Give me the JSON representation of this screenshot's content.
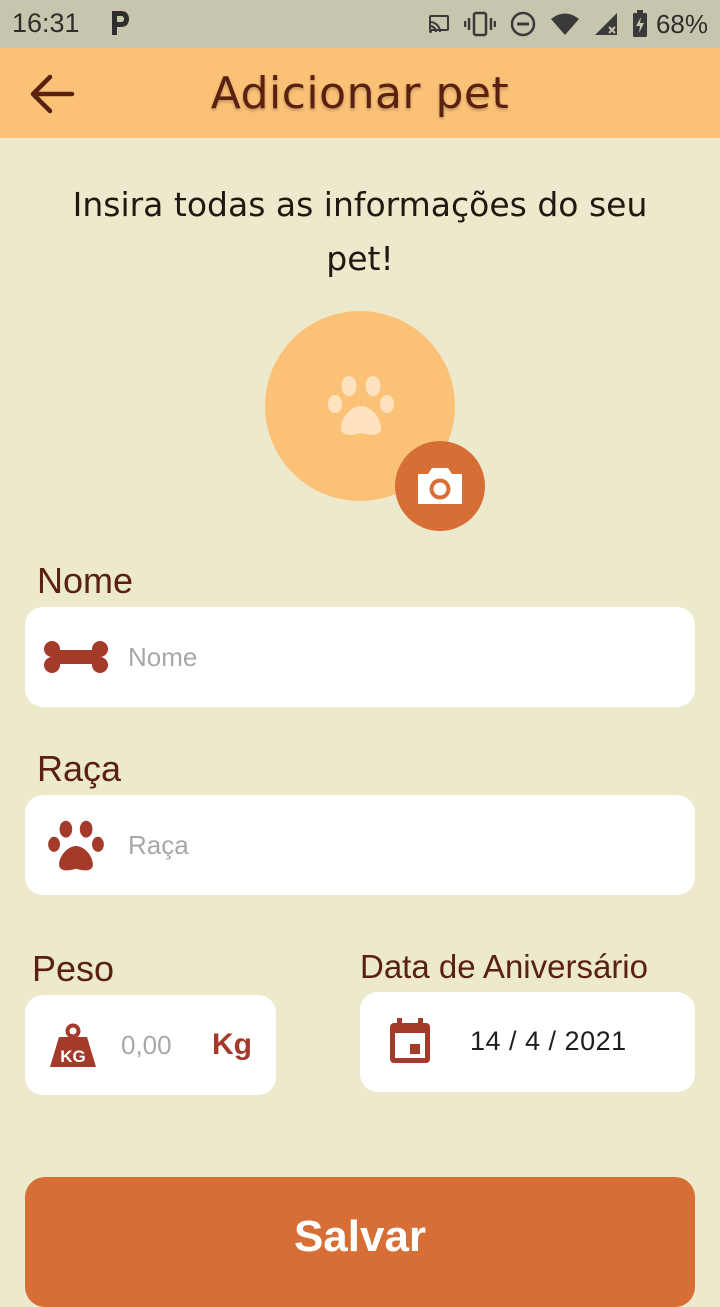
{
  "status_bar": {
    "time": "16:31",
    "battery": "68%",
    "icons": [
      "parking-icon",
      "cast-icon",
      "vibrate-icon",
      "do-not-disturb-icon",
      "wifi-icon",
      "signal-icon",
      "battery-charging-icon"
    ]
  },
  "header": {
    "back_icon": "arrow-left-icon",
    "title": "Adicionar pet"
  },
  "intro_text": "Insira todas as informações do seu pet!",
  "photo": {
    "placeholder_icon": "paw-icon",
    "camera_icon": "camera-icon"
  },
  "form": {
    "name": {
      "label": "Nome",
      "placeholder": "Nome",
      "value": "",
      "icon": "bone-icon"
    },
    "breed": {
      "label": "Raça",
      "placeholder": "Raça",
      "value": "",
      "icon": "paw-icon"
    },
    "weight": {
      "label": "Peso",
      "placeholder": "0,00",
      "value": "",
      "unit": "Kg",
      "icon": "weight-kg-icon"
    },
    "birthday": {
      "label": "Data de Aniversário",
      "value": "14 / 4 / 2021",
      "icon": "calendar-icon"
    }
  },
  "save_button": {
    "label": "Salvar"
  },
  "colors": {
    "background": "#EDE9CC",
    "header": "#FBC277",
    "accent": "#D66E35",
    "text_dark": "#5A2010",
    "icon_red": "#A33A2A"
  }
}
